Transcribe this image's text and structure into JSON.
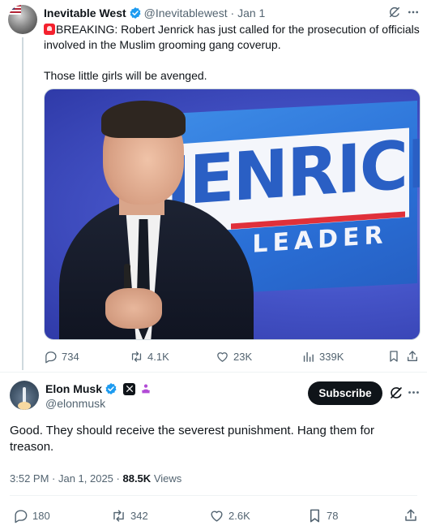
{
  "quoted_tweet": {
    "author_name": "Inevitable West",
    "handle": "@Inevitablewest",
    "date": "Jan 1",
    "text_line1": "BREAKING: Robert Jenrick has just called for the prosecution of officials involved in the Muslim grooming gang coverup.",
    "text_line2": "Those little girls will be avenged.",
    "media": {
      "sign_word": "JENRICK",
      "sign_subtitle": "LEADER"
    },
    "stats": {
      "replies": "734",
      "reposts": "4.1K",
      "likes": "23K",
      "views": "339K"
    }
  },
  "main_tweet": {
    "author_name": "Elon Musk",
    "handle": "@elonmusk",
    "subscribe_label": "Subscribe",
    "text": "Good. They should receive the severest punishment. Hang them for treason.",
    "timestamp": "3:52 PM · Jan 1, 2025",
    "separator": " · ",
    "views_count": "88.5K",
    "views_label": "Views",
    "stats": {
      "replies": "180",
      "reposts": "342",
      "likes": "2.6K",
      "bookmarks": "78"
    }
  },
  "colors": {
    "verified": "#1d9bf0",
    "muted": "#536471",
    "text": "#0f1419",
    "divider": "#eff3f4",
    "gov_badge": "#b24bd6"
  }
}
